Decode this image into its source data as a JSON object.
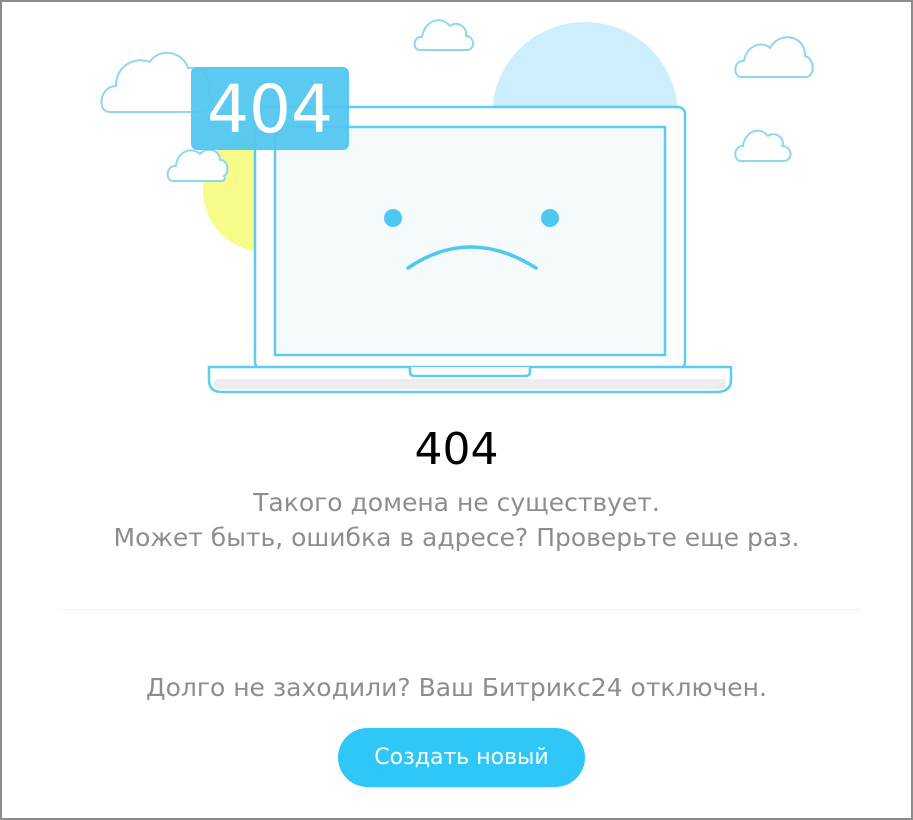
{
  "illustration": {
    "badge_text": "404",
    "colors": {
      "accent": "#4fc8ef",
      "badge": "#52c6ef",
      "sun": "#f6fb8a",
      "sky_circle": "#cdeefc",
      "cloud_stroke": "#8fd6f3",
      "screen": "#f5fafb"
    }
  },
  "error": {
    "code": "404",
    "line1": "Такого домена не существует.",
    "line2": "Может быть, ошибка в адресе? Проверьте еще раз."
  },
  "disabled": {
    "message": "Долго не заходили? Ваш Битрикс24 отключен."
  },
  "button": {
    "label": "Создать новый",
    "color": "#2fc7f7"
  }
}
